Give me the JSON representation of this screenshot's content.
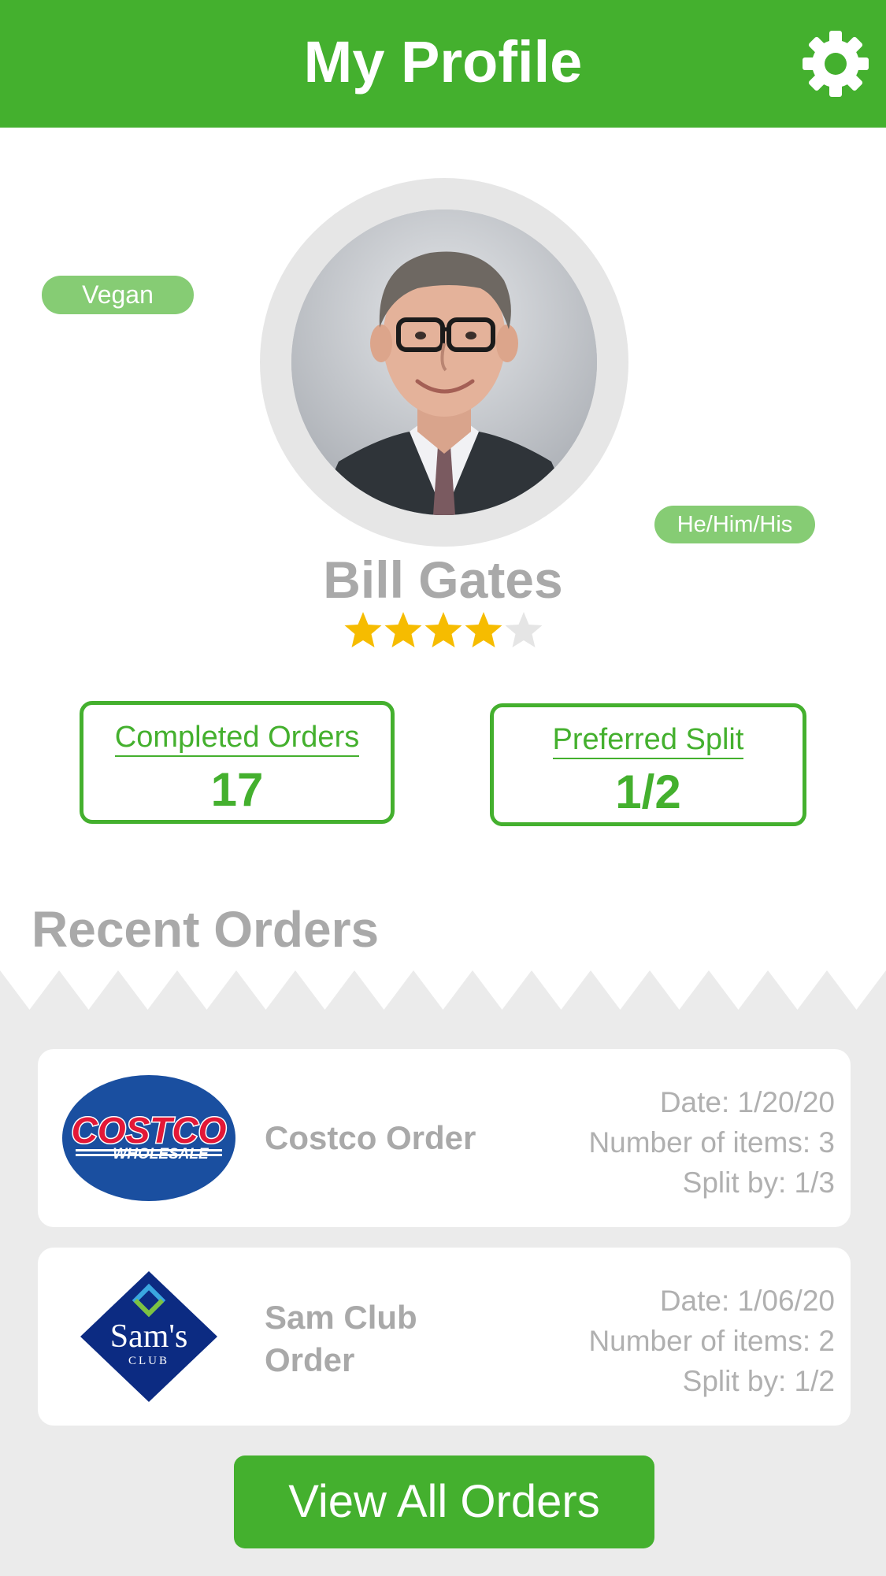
{
  "header": {
    "title": "My Profile",
    "settings_icon": "gear-icon"
  },
  "profile": {
    "name": "Bill Gates",
    "photo": "user-avatar-photo",
    "tags": {
      "diet": "Vegan",
      "pronouns": "He/Him/His"
    },
    "rating": {
      "value": 4,
      "max": 5
    }
  },
  "stats": {
    "completed_orders": {
      "label": "Completed Orders",
      "value": "17"
    },
    "preferred_split": {
      "label": "Preferred Split",
      "value": "1/2"
    }
  },
  "recent_orders": {
    "title": "Recent Orders",
    "orders": [
      {
        "store_logo": "costco-wholesale-logo",
        "logo_text_top": "COSTCO",
        "logo_text_bottom": "WHOLESALE",
        "name": "Costco Order",
        "date": "Date: 1/20/20",
        "items": "Number of items: 3",
        "split": "Split by: 1/3"
      },
      {
        "store_logo": "sams-club-logo",
        "logo_text_top": "Sam's",
        "logo_text_bottom": "CLUB",
        "name": "Sam Club Order",
        "date": "Date: 1/06/20",
        "items": "Number of items: 2",
        "split": "Split by: 1/2"
      }
    ],
    "view_all_label": "View All Orders"
  },
  "colors": {
    "brand_green": "#44b02e",
    "chip_green": "#86cc74",
    "star_filled": "#f6bc00",
    "star_empty": "#e5e5e5",
    "muted_text": "#a9a9a9",
    "orders_bg": "#ebebeb",
    "costco_blue": "#1a4fa0",
    "costco_red": "#e31837",
    "sams_navy": "#0c2b82"
  }
}
